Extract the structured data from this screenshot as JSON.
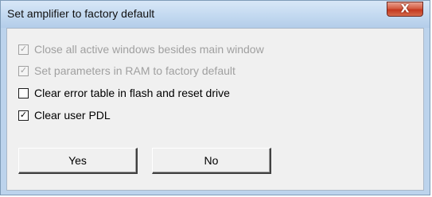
{
  "dialog": {
    "title": "Set amplifier to factory default",
    "close_glyph": "X",
    "options": [
      {
        "label": "Close all active windows besides main window",
        "checked": true,
        "enabled": false
      },
      {
        "label": "Set parameters in RAM to factory default",
        "checked": true,
        "enabled": false
      },
      {
        "label": "Clear error table in flash and reset drive",
        "checked": false,
        "enabled": true
      },
      {
        "label": "Clear user PDL",
        "checked": true,
        "enabled": true
      }
    ],
    "yes_label": "Yes",
    "no_label": "No"
  },
  "colors": {
    "titlebar": "#c3d9f0",
    "client_bg": "#f0f0f0",
    "close_button": "#c4381f",
    "disabled_text": "#a0a0a0"
  },
  "icons": [
    "close-icon",
    "checkmark-icon"
  ]
}
